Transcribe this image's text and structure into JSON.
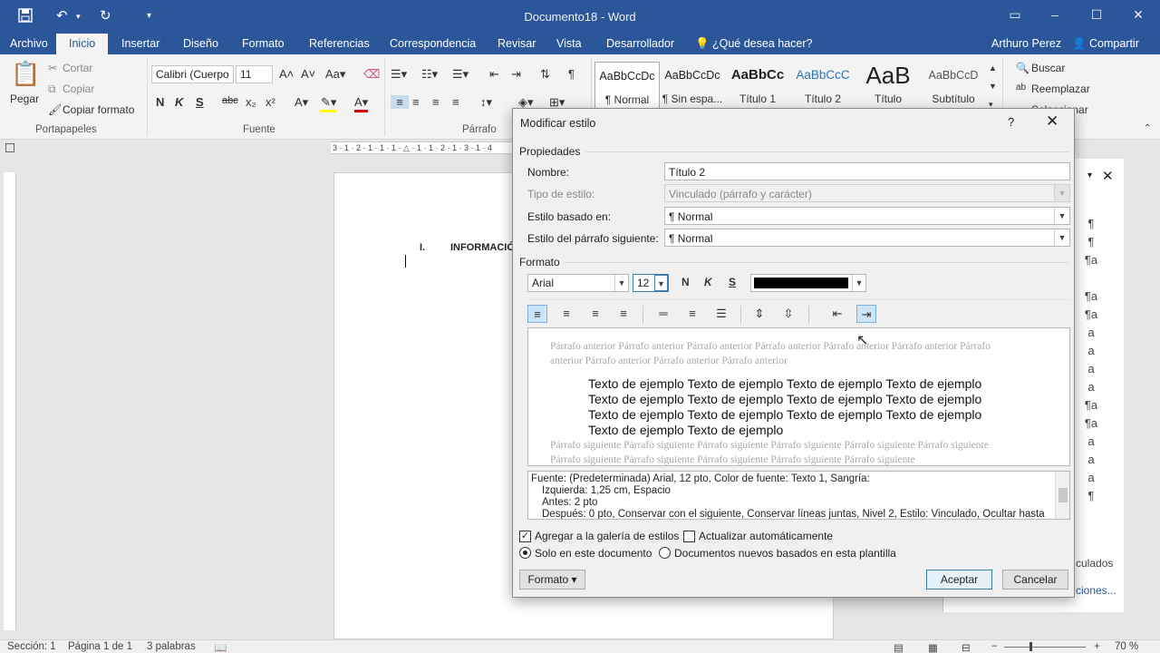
{
  "titlebar": {
    "title": "Documento18 - Word",
    "save_icon": "save-icon",
    "undo_icon": "undo-icon",
    "redo_icon": "repeat-icon"
  },
  "tabs": [
    "Archivo",
    "Inicio",
    "Insertar",
    "Diseño",
    "Formato",
    "Referencias",
    "Correspondencia",
    "Revisar",
    "Vista",
    "Desarrollador"
  ],
  "tell_me": "¿Qué desea hacer?",
  "user": "Arthuro Perez",
  "share": "Compartir",
  "ribbon": {
    "clipboard": {
      "paste": "Pegar",
      "cut": "Cortar",
      "copy": "Copiar",
      "format_painter": "Copiar formato",
      "label": "Portapapeles"
    },
    "font": {
      "font_name": "Calibri (Cuerpo",
      "font_size": "11",
      "label": "Fuente"
    },
    "paragraph": {
      "label": "Párrafo"
    },
    "styles": [
      {
        "sample": "AaBbCcDc",
        "label": "¶ Normal"
      },
      {
        "sample": "AaBbCcDc",
        "label": "¶ Sin espa..."
      },
      {
        "sample": "AaBbCc",
        "label": "Título 1"
      },
      {
        "sample": "AaBbCcC",
        "label": "Título 2"
      },
      {
        "sample": "AaB",
        "label": "Título"
      },
      {
        "sample": "AaBbCcD",
        "label": "Subtítulo"
      }
    ],
    "editing": {
      "find": "Buscar",
      "replace": "Reemplazar",
      "select": "Seleccionar"
    }
  },
  "document": {
    "heading_num": "I.",
    "heading_text": "INFORMACIÓ"
  },
  "styles_pane": {
    "marks": [
      "¶",
      "¶",
      "¶a",
      "",
      "¶a",
      "¶a",
      "a",
      "a",
      "a",
      "a",
      "¶a",
      "¶a",
      "a",
      "a",
      "a",
      "¶"
    ],
    "footer1": "culados",
    "footer2": "ciones..."
  },
  "dialog": {
    "title": "Modificar estilo",
    "properties_label": "Propiedades",
    "name_label": "Nombre:",
    "name_value": "Título 2",
    "type_label": "Tipo de estilo:",
    "type_value": "Vinculado (párrafo y carácter)",
    "based_label": "Estilo basado en:",
    "based_value": "¶  Normal",
    "next_label": "Estilo del párrafo siguiente:",
    "next_value": "¶  Normal",
    "format_label": "Formato",
    "font_value": "Arial",
    "size_value": "12",
    "bold": "N",
    "italic": "K",
    "underline": "S",
    "font_color": "#000000",
    "preview_prev": "Párrafo anterior Párrafo anterior Párrafo anterior Párrafo anterior Párrafo anterior Párrafo anterior Párrafo anterior Párrafo anterior Párrafo anterior Párrafo anterior",
    "preview_sample": "Texto de ejemplo Texto de ejemplo Texto de ejemplo Texto de ejemplo Texto de ejemplo Texto de ejemplo Texto de ejemplo Texto de ejemplo Texto de ejemplo Texto de ejemplo Texto de ejemplo Texto de ejemplo Texto de ejemplo Texto de ejemplo",
    "preview_next": "Párrafo siguiente Párrafo siguiente Párrafo siguiente Párrafo siguiente Párrafo siguiente Párrafo siguiente Párrafo siguiente Párrafo siguiente Párrafo siguiente Párrafo siguiente Párrafo siguiente",
    "desc_line1": "Fuente: (Predeterminada) Arial, 12 pto, Color de fuente: Texto 1, Sangría:",
    "desc_line2": "Izquierda:  1,25 cm, Espacio",
    "desc_line3": "Antes:  2 pto",
    "desc_line4": "Después:  0 pto, Conservar con el siguiente, Conservar líneas juntas, Nivel 2, Estilo: Vinculado, Ocultar hasta",
    "add_gallery": "Agregar a la galería de estilos",
    "add_gallery_checked": true,
    "auto_update": "Actualizar automáticamente",
    "auto_update_checked": false,
    "only_doc": "Solo en este documento",
    "new_docs": "Documentos nuevos basados en esta plantilla",
    "format_button": "Formato ▾",
    "ok": "Aceptar",
    "cancel": "Cancelar"
  },
  "status": {
    "section": "Sección: 1",
    "page": "Página 1 de 1",
    "words": "3 palabras",
    "zoom": "70 %"
  }
}
